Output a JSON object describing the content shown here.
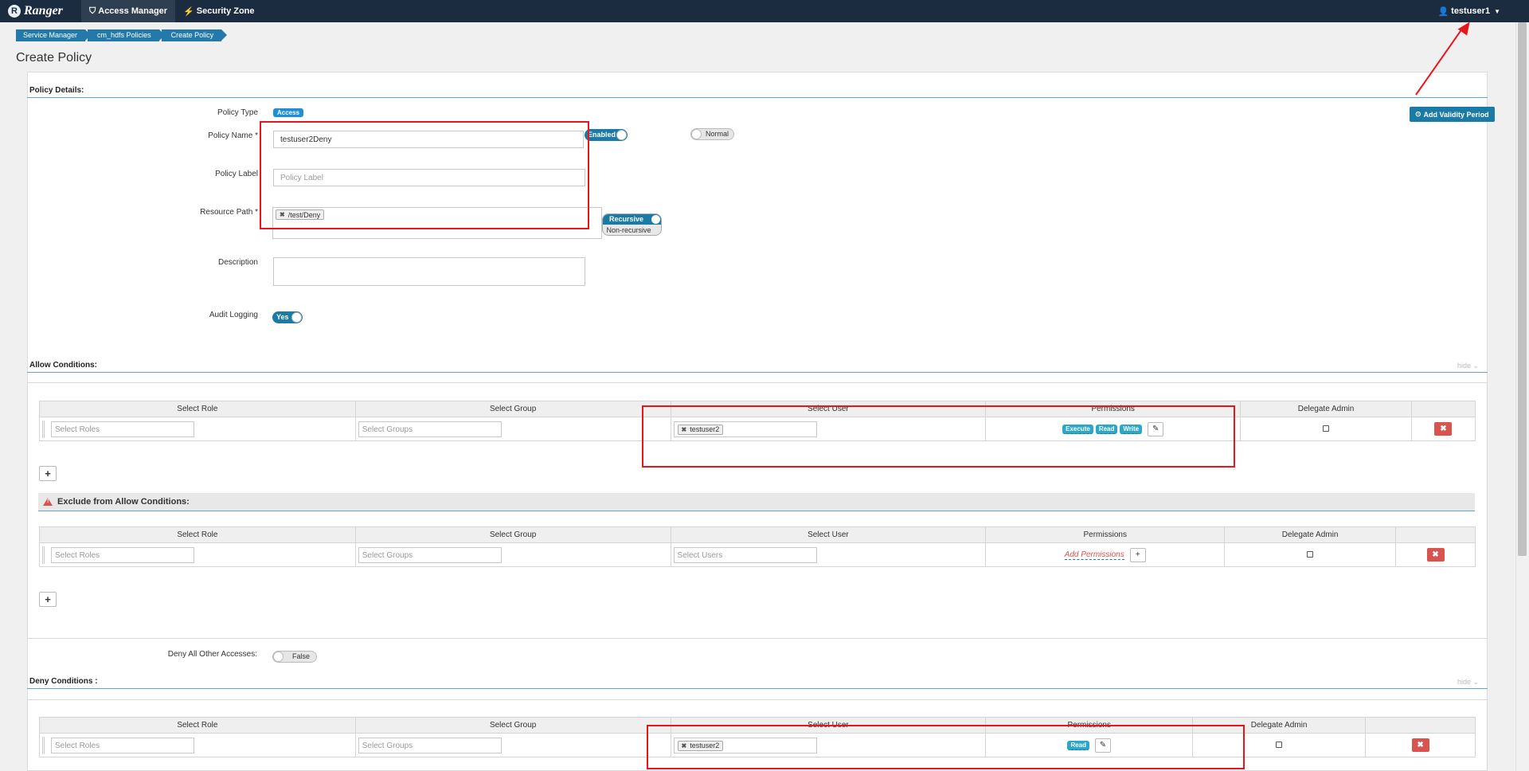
{
  "nav": {
    "brand": "Ranger",
    "access_manager": "Access Manager",
    "security_zone": "Security Zone",
    "user": "testuser1"
  },
  "breadcrumb": [
    "Service Manager",
    "cm_hdfs Policies",
    "Create Policy"
  ],
  "page_title": "Create Policy",
  "policy_details": {
    "title": "Policy Details:",
    "add_validity": "Add Validity Period",
    "policy_type_label": "Policy Type",
    "policy_type": "Access",
    "policy_name_label": "Policy Name *",
    "policy_name": "testuser2Deny",
    "enabled": "Enabled",
    "normal": "Normal",
    "policy_label_label": "Policy Label",
    "policy_label_placeholder": "Policy Label",
    "resource_path_label": "Resource Path *",
    "resource_path": "/test/Deny",
    "recursive": "Recursive",
    "non_recursive": "Non-recursive",
    "description_label": "Description",
    "audit_logging_label": "Audit Logging",
    "audit_logging": "Yes"
  },
  "columns": {
    "role": "Select Role",
    "group": "Select Group",
    "user": "Select User",
    "permissions": "Permissions",
    "delegate": "Delegate Admin"
  },
  "placeholders": {
    "roles": "Select Roles",
    "groups": "Select Groups",
    "users": "Select Users"
  },
  "allow": {
    "title": "Allow Conditions:",
    "hide": "hide",
    "user_tag": "testuser2",
    "permissions": [
      "Execute",
      "Read",
      "Write"
    ]
  },
  "exclude": {
    "title": "Exclude from Allow Conditions:",
    "add_permissions": "Add Permissions"
  },
  "deny_all": {
    "label": "Deny All Other Accesses:",
    "value": "False"
  },
  "deny": {
    "title": "Deny Conditions :",
    "hide": "hide",
    "user_tag": "testuser2",
    "permissions": [
      "Read"
    ]
  },
  "colors": {
    "navbar": "#1b2c40",
    "accent": "#1b7aa6",
    "permission": "#2aa7c9",
    "danger": "#d9534f",
    "annotation": "#e8161c"
  }
}
